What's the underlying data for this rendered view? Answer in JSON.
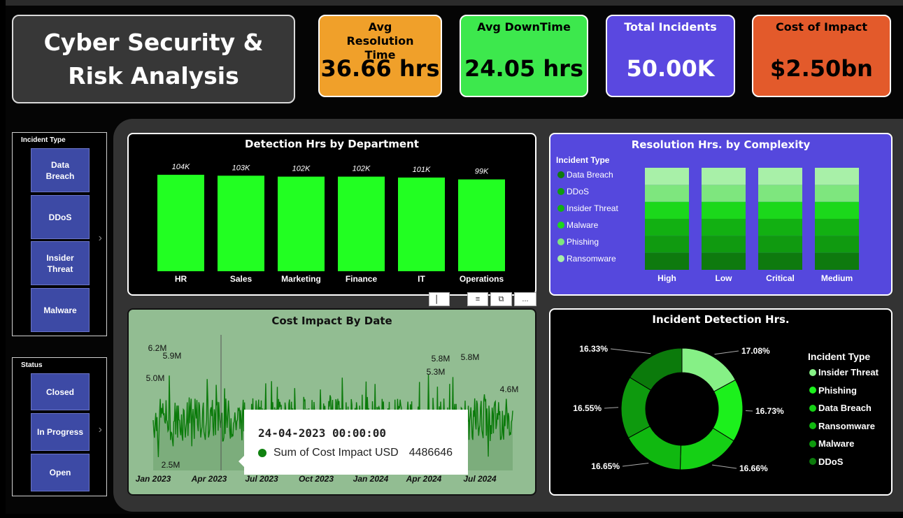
{
  "title": "Cyber Security & Risk Analysis",
  "kpis": [
    {
      "label": "Avg Resolution Time",
      "value": "36.66 hrs",
      "color": "#f0a02a"
    },
    {
      "label": "Avg DownTime",
      "value": "24.05 hrs",
      "color": "#3de84d"
    },
    {
      "label": "Total Incidents",
      "value": "50.00K",
      "color": "#5a48e0"
    },
    {
      "label": "Cost of Impact",
      "value": "$2.50bn",
      "color": "#e35a2b"
    }
  ],
  "slicers": {
    "incident_type": {
      "title": "Incident Type",
      "items": [
        "Data Breach",
        "DDoS",
        "Insider Threat",
        "Malware"
      ]
    },
    "status": {
      "title": "Status",
      "items": [
        "Closed",
        "In Progress",
        "Open"
      ]
    }
  },
  "toolbar": {
    "filter_icon": "filter-icon",
    "focus_icon": "focus-mode-icon",
    "more_icon": "more-options-icon",
    "more_label": "..."
  },
  "tooltip": {
    "title": "24-04-2023 00:00:00",
    "series": "Sum of Cost Impact USD",
    "value": "4486646"
  },
  "charts": {
    "detection_by_department": {
      "type": "bar",
      "title": "Detection Hrs by Department",
      "categories": [
        "HR",
        "Sales",
        "Marketing",
        "Finance",
        "IT",
        "Operations"
      ],
      "values": [
        104,
        103,
        102,
        102,
        101,
        99
      ],
      "labels": [
        "104K",
        "103K",
        "102K",
        "102K",
        "101K",
        "99K"
      ],
      "color": "#22ff22"
    },
    "resolution_by_complexity": {
      "type": "bar",
      "stacked": true,
      "title": "Resolution Hrs. by Complexity",
      "legend_title": "Incident Type",
      "categories": [
        "High",
        "Low",
        "Critical",
        "Medium"
      ],
      "series": [
        {
          "name": "Data Breach",
          "color": "#0e7a0e",
          "values": [
            1,
            1,
            1,
            1
          ]
        },
        {
          "name": "DDoS",
          "color": "#109a10",
          "values": [
            1,
            1,
            1,
            1
          ]
        },
        {
          "name": "Insider Threat",
          "color": "#12b012",
          "values": [
            1,
            1,
            1,
            1
          ]
        },
        {
          "name": "Malware",
          "color": "#1bd81b",
          "values": [
            1,
            1,
            1,
            1
          ]
        },
        {
          "name": "Phishing",
          "color": "#7ee67e",
          "values": [
            1,
            1,
            1,
            1
          ]
        },
        {
          "name": "Ransomware",
          "color": "#a8f0a8",
          "values": [
            1,
            1,
            1,
            1
          ]
        }
      ],
      "background": "#5548dd"
    },
    "cost_by_date": {
      "type": "area",
      "title": "Cost Impact By Date",
      "x_ticks": [
        "Jan 2023",
        "Apr 2023",
        "Jul 2023",
        "Oct 2023",
        "Jan 2024",
        "Apr 2024",
        "Jul 2024"
      ],
      "annotations": [
        "6.2M",
        "5.9M",
        "5.0M",
        "2.5M",
        "5.8M",
        "5.3M",
        "5.8M",
        "4.6M"
      ],
      "ylim": [
        2.0,
        6.5
      ],
      "background": "#92bd92",
      "line_color": "#0a7a0a"
    },
    "detection_donut": {
      "type": "pie",
      "title": "Incident Detection Hrs.",
      "legend_title": "Incident Type",
      "slices": [
        {
          "name": "Insider Threat",
          "value": 17.08,
          "label": "17.08%",
          "color": "#86f086"
        },
        {
          "name": "Phishing",
          "value": 16.73,
          "label": "16.73%",
          "color": "#1cf01c"
        },
        {
          "name": "Data Breach",
          "value": 16.66,
          "label": "16.66%",
          "color": "#15d015"
        },
        {
          "name": "Ransomware",
          "value": 16.65,
          "label": "16.65%",
          "color": "#10b810"
        },
        {
          "name": "Malware",
          "value": 16.55,
          "label": "16.55%",
          "color": "#0e9a0e"
        },
        {
          "name": "DDoS",
          "value": 16.33,
          "label": "16.33%",
          "color": "#0b7a0b"
        }
      ]
    }
  }
}
